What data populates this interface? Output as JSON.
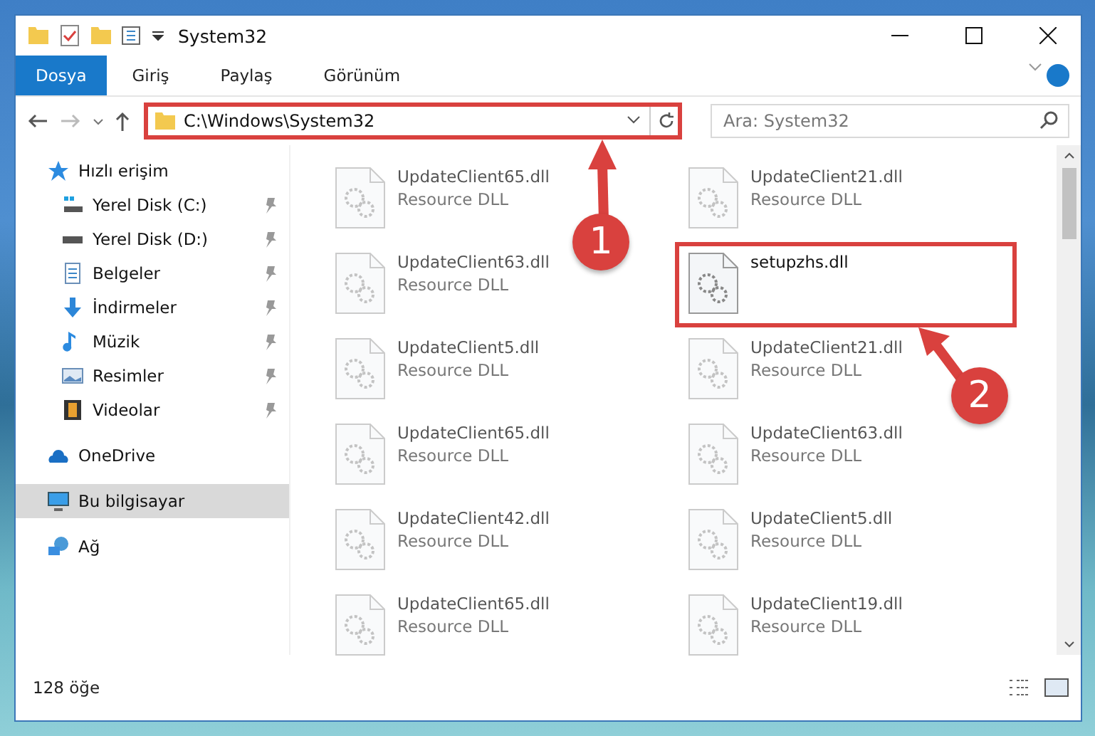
{
  "window": {
    "title": "System32"
  },
  "ribbon_tabs": [
    {
      "label": "Dosya",
      "selected": true
    },
    {
      "label": "Giriş",
      "selected": false
    },
    {
      "label": "Paylaş",
      "selected": false
    },
    {
      "label": "Görünüm",
      "selected": false
    }
  ],
  "address": {
    "path": "C:\\Windows\\System32",
    "highlighted": true,
    "callout": "1"
  },
  "search": {
    "placeholder": "Ara: System32"
  },
  "sidebar": {
    "items": [
      {
        "label": "Hızlı erişim",
        "kind": "star",
        "selected": false,
        "children": [
          {
            "label": "Yerel Disk (C:)",
            "kind": "disk-c",
            "selected": false,
            "pinned": true
          },
          {
            "label": "Yerel Disk (D:)",
            "kind": "disk",
            "selected": false,
            "pinned": true
          },
          {
            "label": "Belgeler",
            "kind": "doc",
            "selected": false,
            "pinned": true
          },
          {
            "label": "İndirmeler",
            "kind": "download",
            "selected": false,
            "pinned": true
          },
          {
            "label": "Müzik",
            "kind": "music",
            "selected": false,
            "pinned": true
          },
          {
            "label": "Resimler",
            "kind": "picture",
            "selected": false,
            "pinned": true
          },
          {
            "label": "Videolar",
            "kind": "video",
            "selected": false,
            "pinned": true
          }
        ]
      },
      {
        "label": "OneDrive",
        "kind": "cloud",
        "selected": false
      },
      {
        "label": "Bu bilgisayar",
        "kind": "pc",
        "selected": true
      },
      {
        "label": "Ağ",
        "kind": "network",
        "selected": false
      }
    ]
  },
  "files": [
    {
      "name": "UpdateClient65.dll",
      "type": "Resource DLL",
      "highlighted": false
    },
    {
      "name": "UpdateClient21.dll",
      "type": "Resource DLL",
      "highlighted": false
    },
    {
      "name": "UpdateClient63.dll",
      "type": "Resource DLL",
      "highlighted": false
    },
    {
      "name": "setupzhs.dll",
      "highlighted": true,
      "callout": "2"
    },
    {
      "name": "UpdateClient5.dll",
      "type": "Resource DLL",
      "highlighted": false
    },
    {
      "name": "UpdateClient21.dll",
      "type": "Resource DLL",
      "highlighted": false
    },
    {
      "name": "UpdateClient65.dll",
      "type": "Resource DLL",
      "highlighted": false
    },
    {
      "name": "UpdateClient63.dll",
      "type": "Resource DLL",
      "highlighted": false
    },
    {
      "name": "UpdateClient42.dll",
      "type": "Resource DLL",
      "highlighted": false
    },
    {
      "name": "UpdateClient5.dll",
      "type": "Resource DLL",
      "highlighted": false
    },
    {
      "name": "UpdateClient65.dll",
      "type": "Resource DLL",
      "highlighted": false
    },
    {
      "name": "UpdateClient19.dll",
      "type": "Resource DLL",
      "highlighted": false
    }
  ],
  "status_bar": {
    "count": "128 öğe"
  }
}
